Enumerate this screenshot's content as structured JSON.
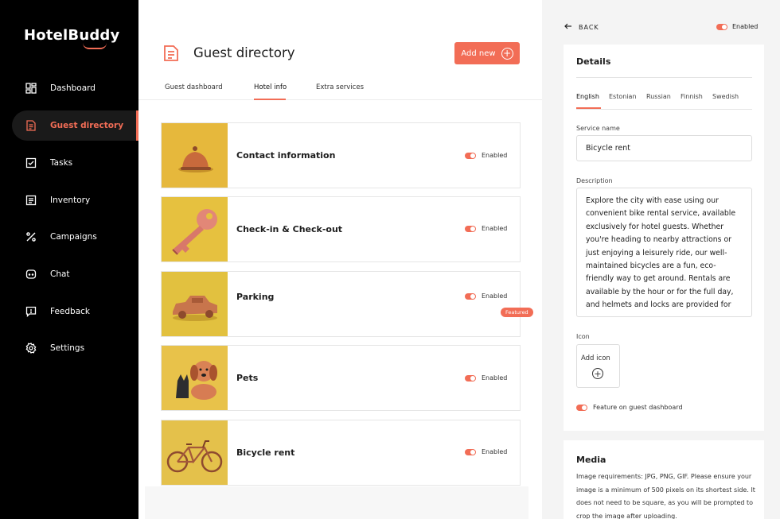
{
  "app": {
    "logo": "HotelBuddy"
  },
  "sidebar": {
    "items": [
      {
        "label": "Dashboard",
        "icon": "dashboard-icon"
      },
      {
        "label": "Guest directory",
        "icon": "document-icon",
        "active": true
      },
      {
        "label": "Tasks",
        "icon": "checkbox-icon"
      },
      {
        "label": "Inventory",
        "icon": "list-icon"
      },
      {
        "label": "Campaigns",
        "icon": "percent-icon"
      },
      {
        "label": "Chat",
        "icon": "chat-icon"
      },
      {
        "label": "Feedback",
        "icon": "feedback-icon"
      },
      {
        "label": "Settings",
        "icon": "gear-icon"
      }
    ]
  },
  "header": {
    "title": "Guest directory",
    "add_label": "Add new",
    "tabs": [
      {
        "label": "Guest dashboard"
      },
      {
        "label": "Hotel info",
        "active": true
      },
      {
        "label": "Extra services"
      }
    ]
  },
  "cards": [
    {
      "name": "Contact information",
      "status": "Enabled",
      "image": "service-bell"
    },
    {
      "name": "Check-in & Check-out",
      "status": "Enabled",
      "image": "key"
    },
    {
      "name": "Parking",
      "status": "Enabled",
      "badge": "Featured",
      "image": "toy-car"
    },
    {
      "name": "Pets",
      "status": "Enabled",
      "image": "dog-and-cat"
    },
    {
      "name": "Bicycle rent",
      "status": "Enabled",
      "image": "bicycle"
    }
  ],
  "detail": {
    "back_label": "BACK",
    "status": "Enabled",
    "details_title": "Details",
    "languages": [
      "English",
      "Estonian",
      "Russian",
      "Finnish",
      "Swedish"
    ],
    "active_language": "English",
    "service_name_label": "Service name",
    "service_name_value": "Bicycle rent",
    "description_label": "Description",
    "description_value": "Explore the city with ease using our convenient bike rental service, available exclusively for hotel guests. Whether you're heading to nearby attractions or just enjoying a leisurely ride, our well-maintained bicycles are a fun, eco-friendly way to get around. Rentals are available by the hour or for the full day, and helmets and locks are provided for",
    "icon_label": "Icon",
    "add_icon_label": "Add icon",
    "feature_label": "Feature on guest dashboard",
    "media_title": "Media",
    "media_text": "Image requirements: JPG, PNG, GIF. Please ensure your image is a minimum of 500 pixels on its shortest side. It does not need to be square, as you will be prompted to crop the image after uploading."
  },
  "colors": {
    "accent": "#f26d56",
    "sidebar_bg": "#000000",
    "panel_bg": "#f4f4f4"
  }
}
